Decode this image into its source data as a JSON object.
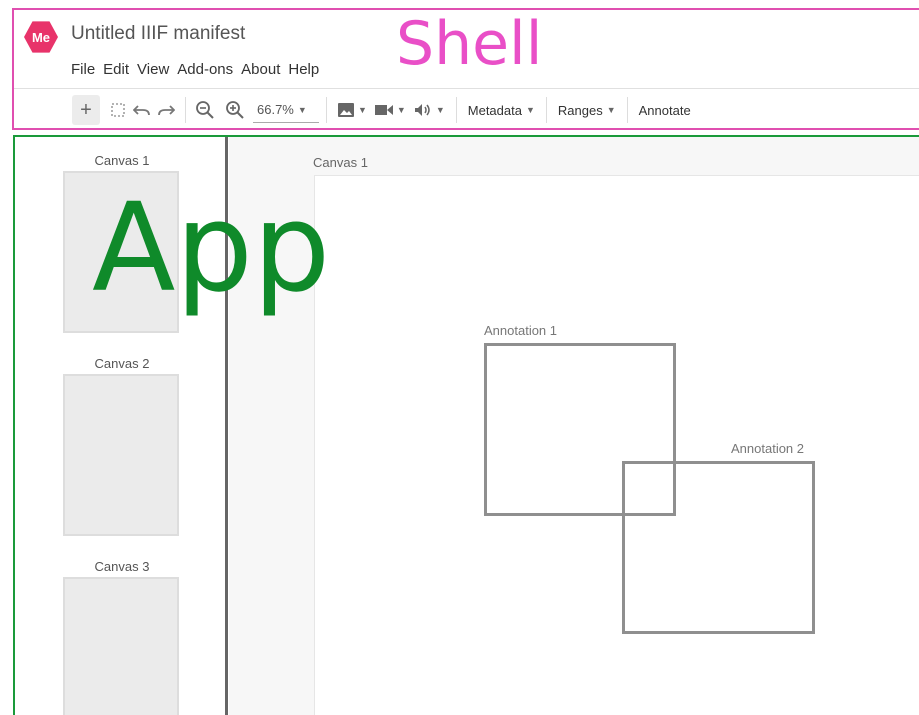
{
  "shell": {
    "logo_text": "Me",
    "title": "Untitled IIIF manifest",
    "region_label": "Shell",
    "region_color": "#e94fc7",
    "menu": [
      "File",
      "Edit",
      "View",
      "Add-ons",
      "About",
      "Help"
    ],
    "toolbar": {
      "zoom_value": "66.7%",
      "metadata_label": "Metadata",
      "ranges_label": "Ranges",
      "annotate_label": "Annotate"
    }
  },
  "app": {
    "region_label": "App",
    "region_color": "#0f8a2a",
    "thumbnails": [
      {
        "label": "Canvas 1"
      },
      {
        "label": "Canvas 2"
      },
      {
        "label": "Canvas 3"
      }
    ],
    "canvas_title": "Canvas 1",
    "annotations": [
      {
        "label": "Annotation 1"
      },
      {
        "label": "Annotation 2"
      }
    ]
  }
}
